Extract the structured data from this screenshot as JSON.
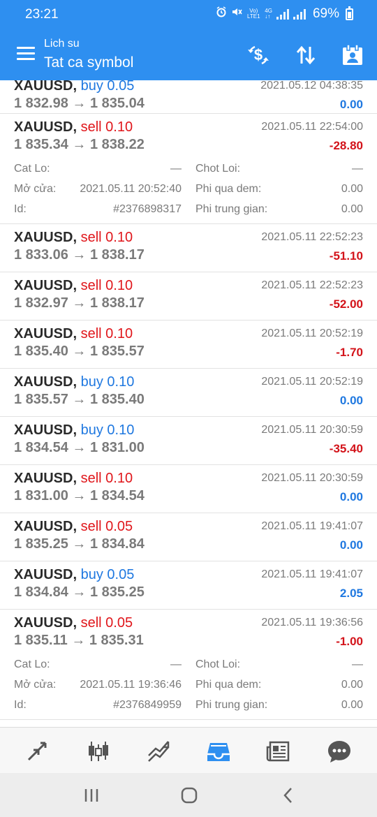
{
  "status_bar": {
    "time": "23:21",
    "network_label": "Vo) 4G\nLTE1",
    "battery": "69%",
    "icons": [
      "alarm-icon",
      "mute-icon",
      "volte-icon",
      "signal-icon",
      "signal-icon",
      "battery-icon"
    ]
  },
  "app_bar": {
    "subtitle": "Lich su",
    "title": "Tat ca symbol",
    "actions": [
      "currency-exchange-icon",
      "sort-icon",
      "calendar-icon"
    ]
  },
  "colors": {
    "primary": "#2e8ff0",
    "buy": "#1f78e0",
    "sell": "#e0161b",
    "loss": "#d3131a"
  },
  "trades": [
    {
      "symbol": "XAUUSD,",
      "side": "buy",
      "volume": "0.05",
      "open_price": "1 832.98",
      "arrow": "→",
      "close_price": "1 835.04",
      "time": "2021.05.12 04:38:35",
      "profit": "0.00",
      "profit_sign": "pos"
    },
    {
      "symbol": "XAUUSD,",
      "side": "sell",
      "volume": "0.10",
      "open_price": "1 835.34",
      "arrow": "→",
      "close_price": "1 838.22",
      "time": "2021.05.11 22:54:00",
      "profit": "-28.80",
      "profit_sign": "neg",
      "details": {
        "sl_label": "Cat Lo:",
        "sl_value": "—",
        "tp_label": "Chot Loi:",
        "tp_value": "—",
        "open_label": "Mở cửa:",
        "open_value": "2021.05.11 20:52:40",
        "swap_label": "Phi qua dem:",
        "swap_value": "0.00",
        "id_label": "Id:",
        "id_value": "#2376898317",
        "comm_label": "Phi trung gian:",
        "comm_value": "0.00"
      }
    },
    {
      "symbol": "XAUUSD,",
      "side": "sell",
      "volume": "0.10",
      "open_price": "1 833.06",
      "arrow": "→",
      "close_price": "1 838.17",
      "time": "2021.05.11 22:52:23",
      "profit": "-51.10",
      "profit_sign": "neg"
    },
    {
      "symbol": "XAUUSD,",
      "side": "sell",
      "volume": "0.10",
      "open_price": "1 832.97",
      "arrow": "→",
      "close_price": "1 838.17",
      "time": "2021.05.11 22:52:23",
      "profit": "-52.00",
      "profit_sign": "neg"
    },
    {
      "symbol": "XAUUSD,",
      "side": "sell",
      "volume": "0.10",
      "open_price": "1 835.40",
      "arrow": "→",
      "close_price": "1 835.57",
      "time": "2021.05.11 20:52:19",
      "profit": "-1.70",
      "profit_sign": "neg"
    },
    {
      "symbol": "XAUUSD,",
      "side": "buy",
      "volume": "0.10",
      "open_price": "1 835.57",
      "arrow": "→",
      "close_price": "1 835.40",
      "time": "2021.05.11 20:52:19",
      "profit": "0.00",
      "profit_sign": "pos"
    },
    {
      "symbol": "XAUUSD,",
      "side": "buy",
      "volume": "0.10",
      "open_price": "1 834.54",
      "arrow": "→",
      "close_price": "1 831.00",
      "time": "2021.05.11 20:30:59",
      "profit": "-35.40",
      "profit_sign": "neg"
    },
    {
      "symbol": "XAUUSD,",
      "side": "sell",
      "volume": "0.10",
      "open_price": "1 831.00",
      "arrow": "→",
      "close_price": "1 834.54",
      "time": "2021.05.11 20:30:59",
      "profit": "0.00",
      "profit_sign": "pos"
    },
    {
      "symbol": "XAUUSD,",
      "side": "sell",
      "volume": "0.05",
      "open_price": "1 835.25",
      "arrow": "→",
      "close_price": "1 834.84",
      "time": "2021.05.11 19:41:07",
      "profit": "0.00",
      "profit_sign": "pos"
    },
    {
      "symbol": "XAUUSD,",
      "side": "buy",
      "volume": "0.05",
      "open_price": "1 834.84",
      "arrow": "→",
      "close_price": "1 835.25",
      "time": "2021.05.11 19:41:07",
      "profit": "2.05",
      "profit_sign": "pos"
    },
    {
      "symbol": "XAUUSD,",
      "side": "sell",
      "volume": "0.05",
      "open_price": "1 835.11",
      "arrow": "→",
      "close_price": "1 835.31",
      "time": "2021.05.11 19:36:56",
      "profit": "-1.00",
      "profit_sign": "neg",
      "details": {
        "sl_label": "Cat Lo:",
        "sl_value": "—",
        "tp_label": "Chot Loi:",
        "tp_value": "—",
        "open_label": "Mở cửa:",
        "open_value": "2021.05.11 19:36:46",
        "swap_label": "Phi qua dem:",
        "swap_value": "0.00",
        "id_label": "Id:",
        "id_value": "#2376849959",
        "comm_label": "Phi trung gian:",
        "comm_value": "0.00"
      }
    }
  ],
  "tab_bar": {
    "tabs": [
      "quotes-icon",
      "chart-icon",
      "trade-icon",
      "history-icon",
      "news-icon",
      "chat-icon"
    ],
    "active": "history-icon"
  },
  "nav_bar": {
    "buttons": [
      "recent-apps-icon",
      "home-icon",
      "back-icon"
    ]
  }
}
